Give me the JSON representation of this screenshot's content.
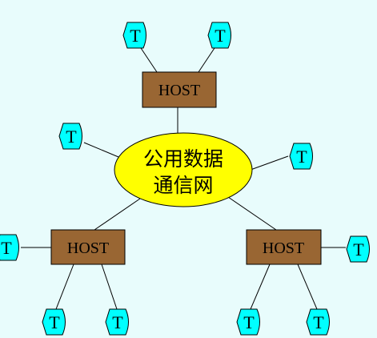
{
  "diagram": {
    "center": {
      "lines": [
        "公用数据",
        "通信网"
      ]
    },
    "host_label": "HOST",
    "terminal_label": "T",
    "colors": {
      "background": "#e8fcfc",
      "center_fill": "#ffff00",
      "host_fill": "#996633",
      "terminal_fill": "#00ffff",
      "stroke": "#000000"
    }
  }
}
